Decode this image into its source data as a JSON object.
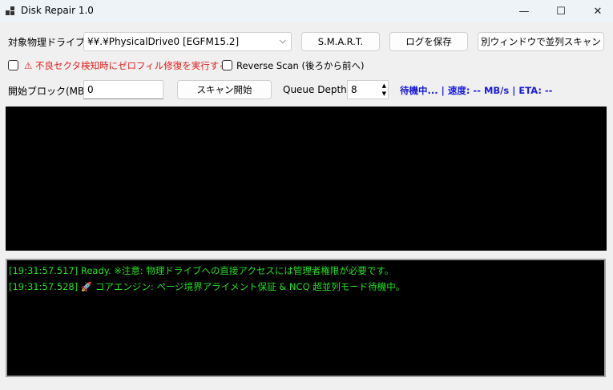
{
  "window": {
    "title": "Disk Repair 1.0",
    "minimize": "—",
    "maximize": "☐",
    "close": "✕"
  },
  "drive": {
    "label": "対象物理ドライブ:",
    "value": "¥¥.¥PhysicalDrive0 [EGFM15.2]"
  },
  "buttons": {
    "smart": "S.M.A.R.T.",
    "save_log": "ログを保存",
    "parallel": "別ウィンドウで並列スキャン",
    "start_scan": "スキャン開始"
  },
  "options": {
    "zero_fill_warn": "⚠",
    "zero_fill": "不良セクタ検知時にゼロフィル修復を実行する",
    "reverse": "Reverse Scan (後ろから前へ)"
  },
  "start_block": {
    "label": "開始ブロック(MB):",
    "value": "0"
  },
  "queue": {
    "label": "Queue Depth:",
    "value": "8"
  },
  "status": "待機中... | 速度: -- MB/s | ETA: --",
  "colors": {
    "status": "#1a1adc",
    "warning": "#e02020",
    "log": "#22e022"
  },
  "log": [
    "[19:31:57.517] Ready. ※注意: 物理ドライブへの直接アクセスには管理者権限が必要です。",
    "[19:31:57.528] 🚀 コアエンジン: ページ境界アライメント保証 & NCQ 超並列モード待機中。"
  ]
}
